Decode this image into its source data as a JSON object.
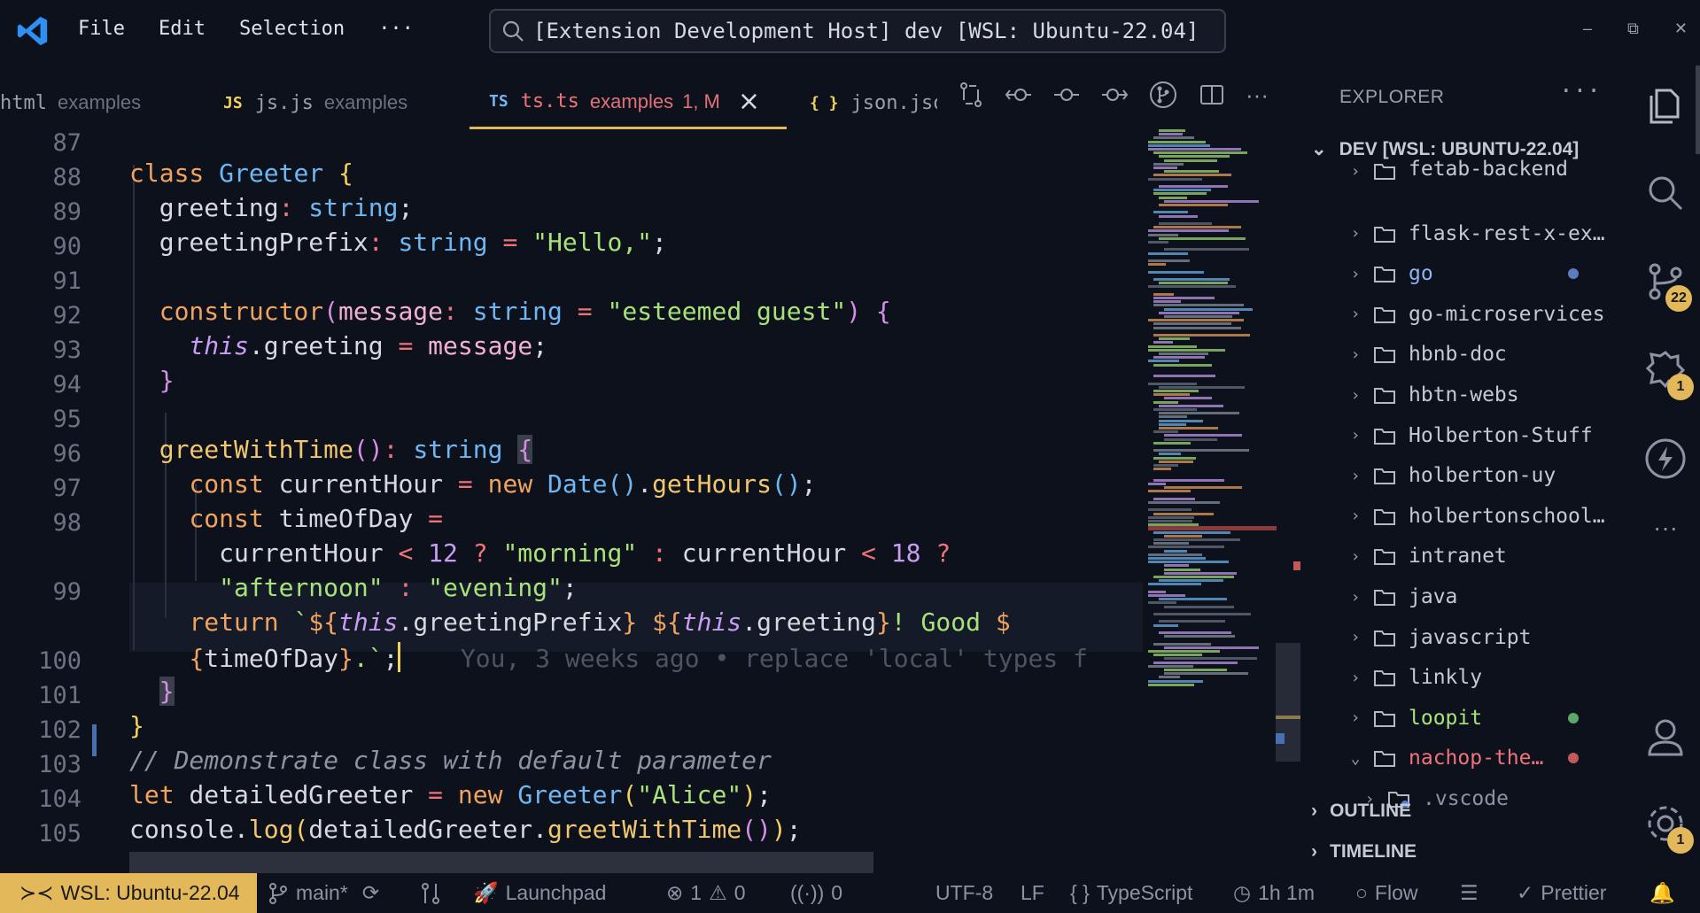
{
  "titlebar": {
    "menu": [
      "File",
      "Edit",
      "Selection",
      "···"
    ],
    "search_text": "[Extension Development Host] dev [WSL: Ubuntu-22.04]",
    "win_min": "–",
    "win_max": "⧉",
    "win_close": "✕"
  },
  "tabs": [
    {
      "icon": "",
      "name": "html",
      "desc": "examples"
    },
    {
      "icon": "JS",
      "name": "js.js",
      "desc": "examples"
    },
    {
      "icon": "TS",
      "name": "ts.ts",
      "desc": "examples",
      "status": "1, M"
    },
    {
      "icon": "{ }",
      "name": "json.jso",
      "desc": ""
    }
  ],
  "editor": {
    "line_numbers": [
      "87",
      "88",
      "89",
      "90",
      "91",
      "92",
      "93",
      "94",
      "95",
      "96",
      "97",
      "98",
      "",
      "99",
      "",
      "100",
      "101",
      "102",
      "103",
      "104",
      "105"
    ],
    "blame": "You, 3 weeks ago • replace 'local' types f"
  },
  "explorer": {
    "title": "EXPLORER",
    "more": "···",
    "workspace": "DEV [WSL: UBUNTU-22.04]",
    "items": [
      {
        "name": "fetab-backend",
        "color": "#c5c9d3",
        "open": false
      },
      {
        "name": "flask-rest-x-ex…",
        "color": "#c5c9d3",
        "open": false
      },
      {
        "name": "go",
        "color": "#8fb3f2",
        "dot": "#5a7dc2",
        "open": false
      },
      {
        "name": "go-microservices",
        "color": "#c5c9d3",
        "open": false
      },
      {
        "name": "hbnb-doc",
        "color": "#c5c9d3",
        "open": false
      },
      {
        "name": "hbtn-webs",
        "color": "#c5c9d3",
        "open": false
      },
      {
        "name": "Holberton-Stuff",
        "color": "#c5c9d3",
        "open": false
      },
      {
        "name": "holberton-uy",
        "color": "#c5c9d3",
        "open": false
      },
      {
        "name": "holbertonschool…",
        "color": "#c5c9d3",
        "open": false
      },
      {
        "name": "intranet",
        "color": "#c5c9d3",
        "open": false
      },
      {
        "name": "java",
        "color": "#c5c9d3",
        "open": false
      },
      {
        "name": "javascript",
        "color": "#c5c9d3",
        "open": false
      },
      {
        "name": "linkly",
        "color": "#c5c9d3",
        "open": false
      },
      {
        "name": "loopit",
        "color": "#a8e27a",
        "dot": "#5aa867",
        "open": false
      },
      {
        "name": "nachop-the…",
        "color": "#f0737a",
        "dot": "#c25a5a",
        "open": true
      },
      {
        "name": ".vscode",
        "color": "#8c93a3",
        "open": false,
        "child": true
      }
    ],
    "outline": "OUTLINE",
    "timeline": "TIMELINE"
  },
  "activity": {
    "scm_badge": "22",
    "debug_badge": "1",
    "settings_badge": "1",
    "more": "···"
  },
  "statusbar": {
    "remote": "WSL: Ubuntu-22.04",
    "branch": "main*",
    "launchpad": "Launchpad",
    "errors": "1",
    "warnings": "0",
    "ports": "0",
    "encoding": "UTF-8",
    "eol": "LF",
    "language": "TypeScript",
    "time": "1h 1m",
    "flow": "Flow",
    "prettier": "Prettier"
  },
  "colors": {
    "accent": "#e2b85a",
    "background": "#0d111b",
    "error": "#f0737a"
  }
}
